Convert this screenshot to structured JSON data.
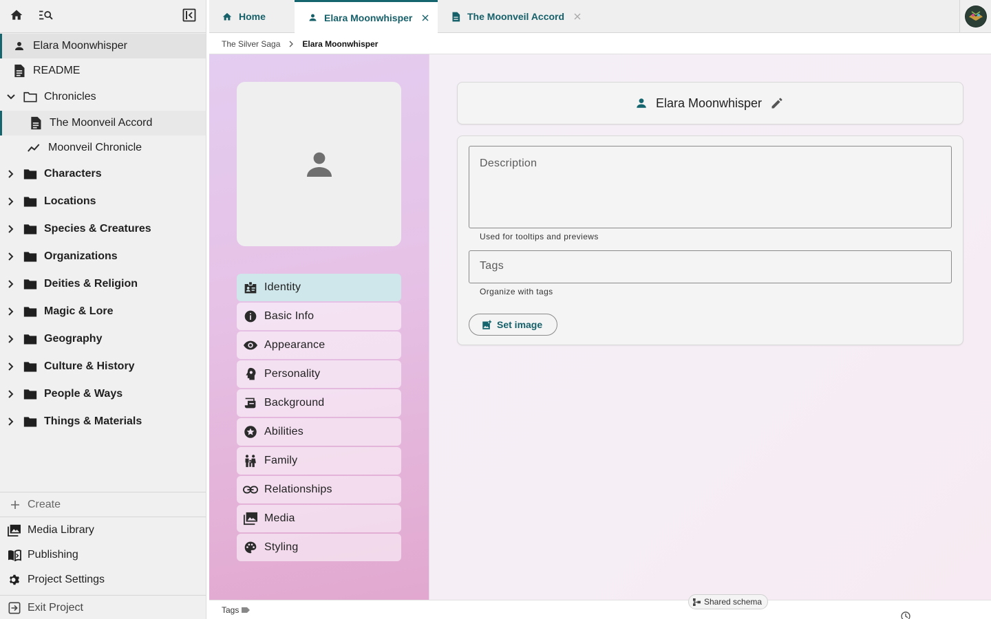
{
  "colors": {
    "accent": "#14656e",
    "sidebar_bg": "#f0f0f0",
    "active_nav": "#cfe6ea"
  },
  "sidebar": {
    "top_icons": [
      "home-icon",
      "search-tree-icon",
      "collapse-sidebar-icon"
    ],
    "tree": [
      {
        "label": "Elara Moonwhisper",
        "icon": "person-icon",
        "active": true
      },
      {
        "label": "README",
        "icon": "document-icon"
      },
      {
        "label": "Chronicles",
        "icon": "folder-open-icon",
        "expanded": true
      },
      {
        "label": "The Moonveil Accord",
        "icon": "document-icon"
      },
      {
        "label": "Moonveil Chronicle",
        "icon": "timeline-icon"
      },
      {
        "label": "Characters",
        "icon": "folder-icon"
      },
      {
        "label": "Locations",
        "icon": "folder-icon"
      },
      {
        "label": "Species & Creatures",
        "icon": "folder-icon"
      },
      {
        "label": "Organizations",
        "icon": "folder-icon"
      },
      {
        "label": "Deities & Religion",
        "icon": "folder-icon"
      },
      {
        "label": "Magic & Lore",
        "icon": "folder-icon"
      },
      {
        "label": "Geography",
        "icon": "folder-icon"
      },
      {
        "label": "Culture & History",
        "icon": "folder-icon"
      },
      {
        "label": "People & Ways",
        "icon": "folder-icon"
      },
      {
        "label": "Things & Materials",
        "icon": "folder-icon"
      }
    ],
    "create_label": "Create",
    "bottom": [
      {
        "label": "Media Library",
        "icon": "media-library-icon"
      },
      {
        "label": "Publishing",
        "icon": "publishing-icon"
      },
      {
        "label": "Project Settings",
        "icon": "gear-icon"
      }
    ],
    "exit_label": "Exit Project"
  },
  "tabs": [
    {
      "label": "Home",
      "icon": "home-icon",
      "closable": false
    },
    {
      "label": "Elara Moonwhisper",
      "icon": "person-icon",
      "active": true,
      "closable": true
    },
    {
      "label": "The Moonveil Accord",
      "icon": "document-icon",
      "closable": true
    }
  ],
  "breadcrumb": {
    "parent": "The Silver Saga",
    "current": "Elara Moonwhisper"
  },
  "nav": [
    {
      "label": "Identity",
      "icon": "badge-icon",
      "active": true
    },
    {
      "label": "Basic Info",
      "icon": "info-icon"
    },
    {
      "label": "Appearance",
      "icon": "eye-icon"
    },
    {
      "label": "Personality",
      "icon": "head-icon"
    },
    {
      "label": "Background",
      "icon": "scroll-icon"
    },
    {
      "label": "Abilities",
      "icon": "star-icon"
    },
    {
      "label": "Family",
      "icon": "family-icon"
    },
    {
      "label": "Relationships",
      "icon": "link-icon"
    },
    {
      "label": "Media",
      "icon": "image-icon"
    },
    {
      "label": "Styling",
      "icon": "palette-icon"
    }
  ],
  "entity": {
    "name": "Elara Moonwhisper"
  },
  "form": {
    "description": {
      "placeholder": "Description",
      "value": "",
      "hint": "Used for tooltips and previews"
    },
    "tags": {
      "placeholder": "Tags",
      "value": "",
      "hint": "Organize with tags"
    },
    "set_image_label": "Set image"
  },
  "status": {
    "tags_label": "Tags",
    "schema_label": "Shared schema"
  }
}
